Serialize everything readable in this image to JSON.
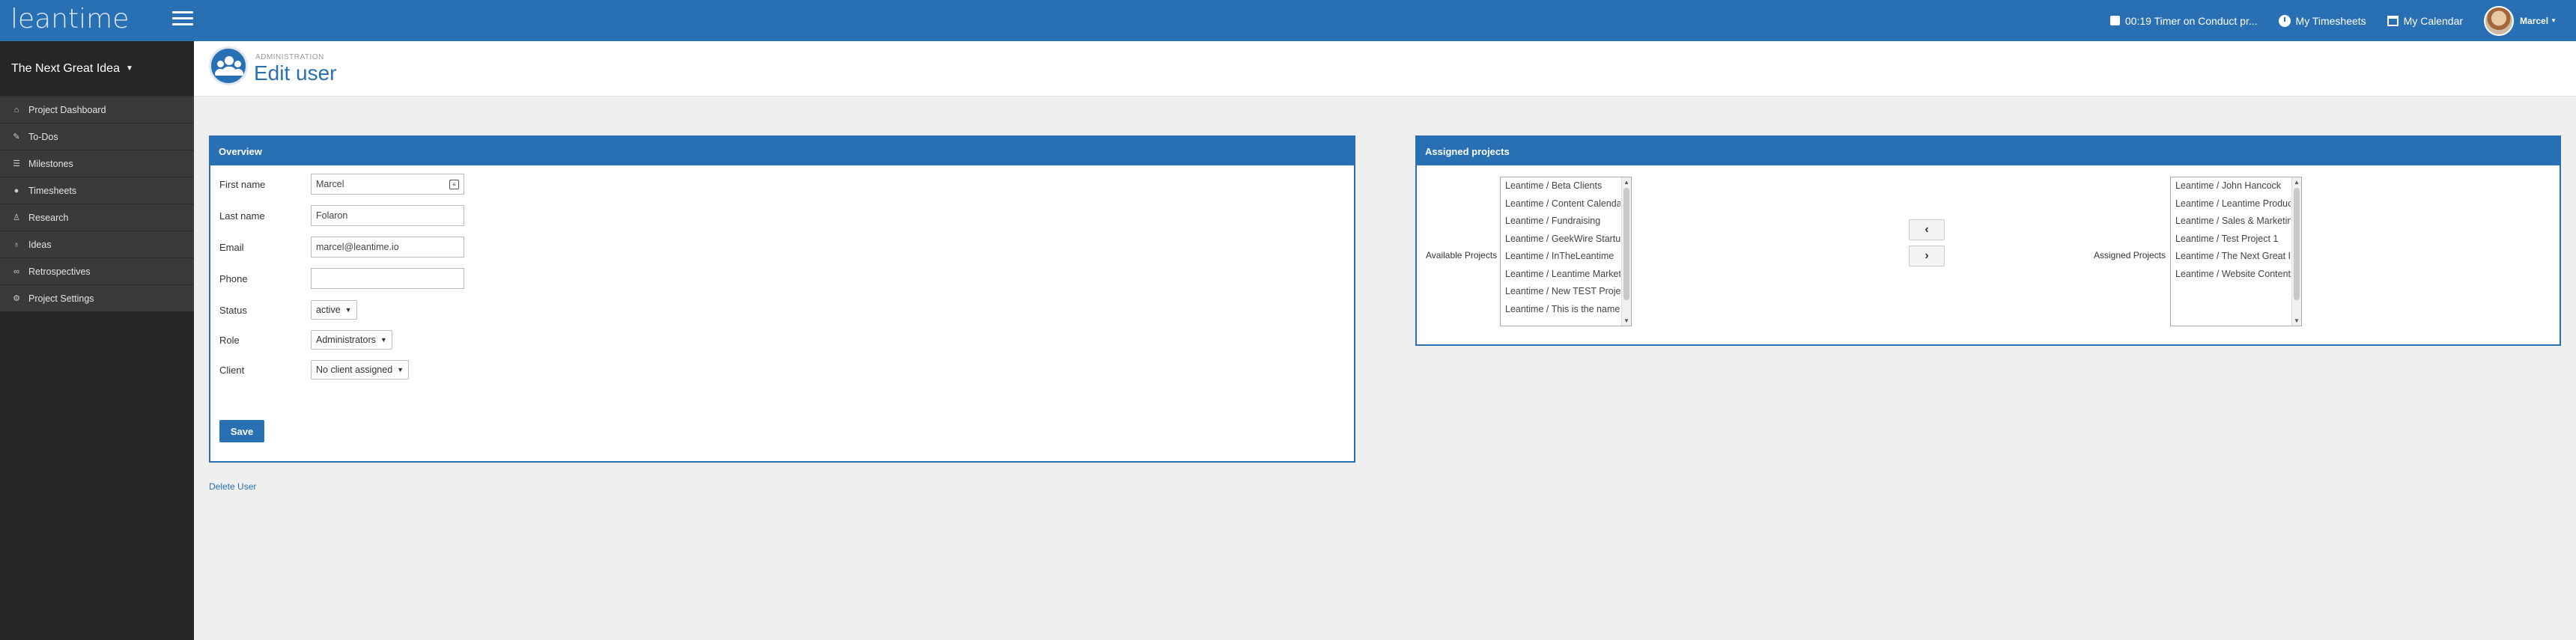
{
  "header": {
    "logo": "leantime",
    "timer_label": "00:19 Timer on Conduct pr...",
    "timesheets_label": "My Timesheets",
    "calendar_label": "My Calendar",
    "user_label": "Marcel"
  },
  "sidebar": {
    "project_name": "The Next Great Idea",
    "items": [
      {
        "label": "Project Dashboard",
        "icon": "home-icon"
      },
      {
        "label": "To-Dos",
        "icon": "thumbtack-icon"
      },
      {
        "label": "Milestones",
        "icon": "list-icon"
      },
      {
        "label": "Timesheets",
        "icon": "clock-icon"
      },
      {
        "label": "Research",
        "icon": "user-icon"
      },
      {
        "label": "Ideas",
        "icon": "lightbulb-icon"
      },
      {
        "label": "Retrospectives",
        "icon": "binoculars-icon"
      },
      {
        "label": "Project Settings",
        "icon": "gear-icon"
      }
    ]
  },
  "page": {
    "subtitle": "ADMINISTRATION",
    "title": "Edit user"
  },
  "overview": {
    "heading": "Overview",
    "first_name_label": "First name",
    "first_name_value": "Marcel",
    "last_name_label": "Last name",
    "last_name_value": "Folaron",
    "email_label": "Email",
    "email_value": "marcel@leantime.io",
    "phone_label": "Phone",
    "phone_value": "",
    "status_label": "Status",
    "status_value": "active",
    "role_label": "Role",
    "role_value": "Administrators",
    "client_label": "Client",
    "client_value": "No client assigned",
    "save_label": "Save"
  },
  "delete_user_label": "Delete User",
  "projects": {
    "heading": "Assigned projects",
    "available_label": "Available Projects",
    "assigned_label": "Assigned Projects",
    "available": [
      "Leantime / Beta Clients",
      "Leantime / Content Calendar",
      "Leantime / Fundraising",
      "Leantime / GeekWire Startup",
      "Leantime / InTheLeantime",
      "Leantime / Leantime Marketing",
      "Leantime / New TEST Project",
      "Leantime / This is the name"
    ],
    "assigned": [
      "Leantime / John Hancock",
      "Leantime / Leantime Product",
      "Leantime / Sales & Marketing",
      "Leantime / Test Project 1",
      "Leantime / The Next Great Idea",
      "Leantime / Website Content"
    ],
    "move_left_label": "‹",
    "move_right_label": "›"
  },
  "colors": {
    "primary": "#2870b3",
    "sidebar_bg": "#262626",
    "sidebar_item_bg": "#3a3a3a"
  }
}
